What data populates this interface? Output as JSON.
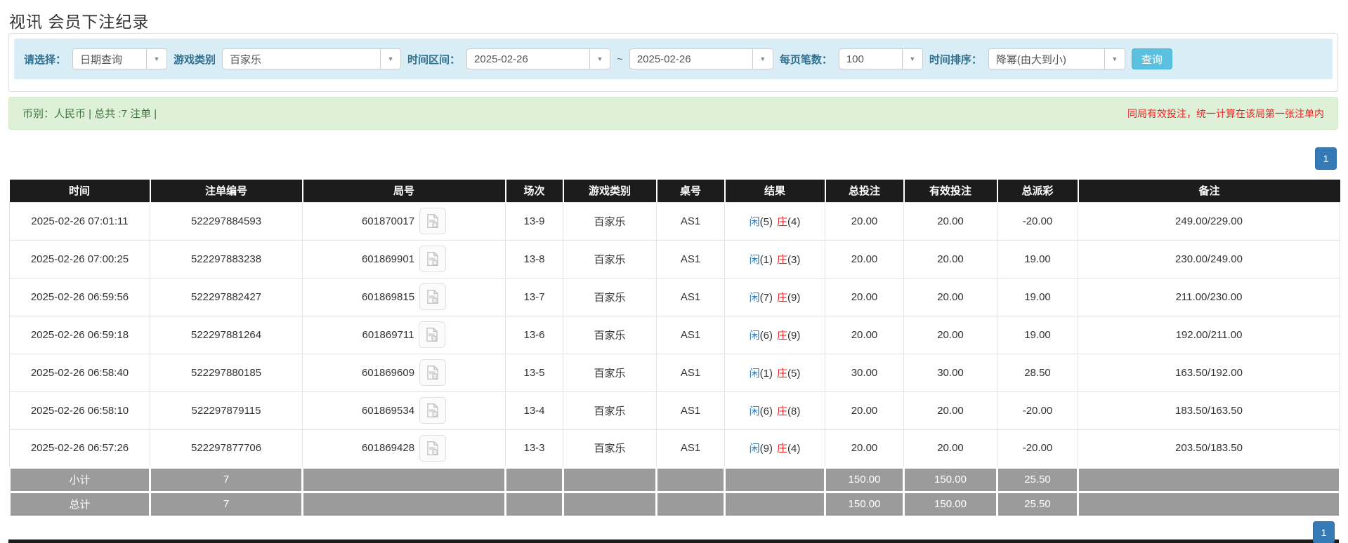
{
  "page": {
    "title": "视讯 会员下注纪录"
  },
  "colors": {
    "accent_blue": "#337ab7",
    "button_blue": "#5bc0de",
    "filter_bg": "#d9edf7",
    "label_blue": "#31708f",
    "success_bg": "#dff0d8",
    "success_text": "#3c763d",
    "red": "#ee2222",
    "header_bg": "#1c1c1c",
    "footer_gray": "#9b9b9b"
  },
  "filters": {
    "select_label": "请选择：",
    "select_value": "日期查询",
    "game_type_label": "游戏类别",
    "game_type_value": "百家乐",
    "date_range_label": "时间区间：",
    "date_from": "2025-02-26",
    "date_separator": "~",
    "date_to": "2025-02-26",
    "page_size_label": "每页笔数：",
    "page_size_value": "100",
    "sort_label": "时间排序：",
    "sort_value": "降幂(由大到小)",
    "query_button": "查询",
    "caret": "▼"
  },
  "summary": {
    "left_text": "币别：人民币 | 总共 :7 注单 |",
    "right_note": "同局有效投注，统一计算在该局第一张注单内"
  },
  "pagination": {
    "current_page": "1"
  },
  "table": {
    "columns": [
      "时间",
      "注单编号",
      "局号",
      "场次",
      "游戏类别",
      "桌号",
      "结果",
      "总投注",
      "有效投注",
      "总派彩",
      "备注"
    ],
    "rows": [
      {
        "time": "2025-02-26 07:01:11",
        "bet_id": "522297884593",
        "round_id": "601870017",
        "session": "13-9",
        "game": "百家乐",
        "table_no": "AS1",
        "result": {
          "p": "闲",
          "pn": "(5)",
          "b": "庄",
          "bn": "(4)"
        },
        "total_bet": "20.00",
        "valid_bet": "20.00",
        "payout": "-20.00",
        "payout_negative": true,
        "remark": "249.00/229.00"
      },
      {
        "time": "2025-02-26 07:00:25",
        "bet_id": "522297883238",
        "round_id": "601869901",
        "session": "13-8",
        "game": "百家乐",
        "table_no": "AS1",
        "result": {
          "p": "闲",
          "pn": "(1)",
          "b": "庄",
          "bn": "(3)"
        },
        "total_bet": "20.00",
        "valid_bet": "20.00",
        "payout": "19.00",
        "payout_negative": false,
        "remark": "230.00/249.00"
      },
      {
        "time": "2025-02-26 06:59:56",
        "bet_id": "522297882427",
        "round_id": "601869815",
        "session": "13-7",
        "game": "百家乐",
        "table_no": "AS1",
        "result": {
          "p": "闲",
          "pn": "(7)",
          "b": "庄",
          "bn": "(9)"
        },
        "total_bet": "20.00",
        "valid_bet": "20.00",
        "payout": "19.00",
        "payout_negative": false,
        "remark": "211.00/230.00"
      },
      {
        "time": "2025-02-26 06:59:18",
        "bet_id": "522297881264",
        "round_id": "601869711",
        "session": "13-6",
        "game": "百家乐",
        "table_no": "AS1",
        "result": {
          "p": "闲",
          "pn": "(6)",
          "b": "庄",
          "bn": "(9)"
        },
        "total_bet": "20.00",
        "valid_bet": "20.00",
        "payout": "19.00",
        "payout_negative": false,
        "remark": "192.00/211.00"
      },
      {
        "time": "2025-02-26 06:58:40",
        "bet_id": "522297880185",
        "round_id": "601869609",
        "session": "13-5",
        "game": "百家乐",
        "table_no": "AS1",
        "result": {
          "p": "闲",
          "pn": "(1)",
          "b": "庄",
          "bn": "(5)"
        },
        "total_bet": "30.00",
        "valid_bet": "30.00",
        "payout": "28.50",
        "payout_negative": false,
        "remark": "163.50/192.00"
      },
      {
        "time": "2025-02-26 06:58:10",
        "bet_id": "522297879115",
        "round_id": "601869534",
        "session": "13-4",
        "game": "百家乐",
        "table_no": "AS1",
        "result": {
          "p": "闲",
          "pn": "(6)",
          "b": "庄",
          "bn": "(8)"
        },
        "total_bet": "20.00",
        "valid_bet": "20.00",
        "payout": "-20.00",
        "payout_negative": true,
        "remark": "183.50/163.50"
      },
      {
        "time": "2025-02-26 06:57:26",
        "bet_id": "522297877706",
        "round_id": "601869428",
        "session": "13-3",
        "game": "百家乐",
        "table_no": "AS1",
        "result": {
          "p": "闲",
          "pn": "(9)",
          "b": "庄",
          "bn": "(4)"
        },
        "total_bet": "20.00",
        "valid_bet": "20.00",
        "payout": "-20.00",
        "payout_negative": true,
        "remark": "203.50/183.50"
      }
    ],
    "subtotal": {
      "label": "小计",
      "count": "7",
      "total_bet": "150.00",
      "valid_bet": "150.00",
      "payout": "25.50"
    },
    "total": {
      "label": "总计",
      "count": "7",
      "total_bet": "150.00",
      "valid_bet": "150.00",
      "payout": "25.50"
    }
  }
}
